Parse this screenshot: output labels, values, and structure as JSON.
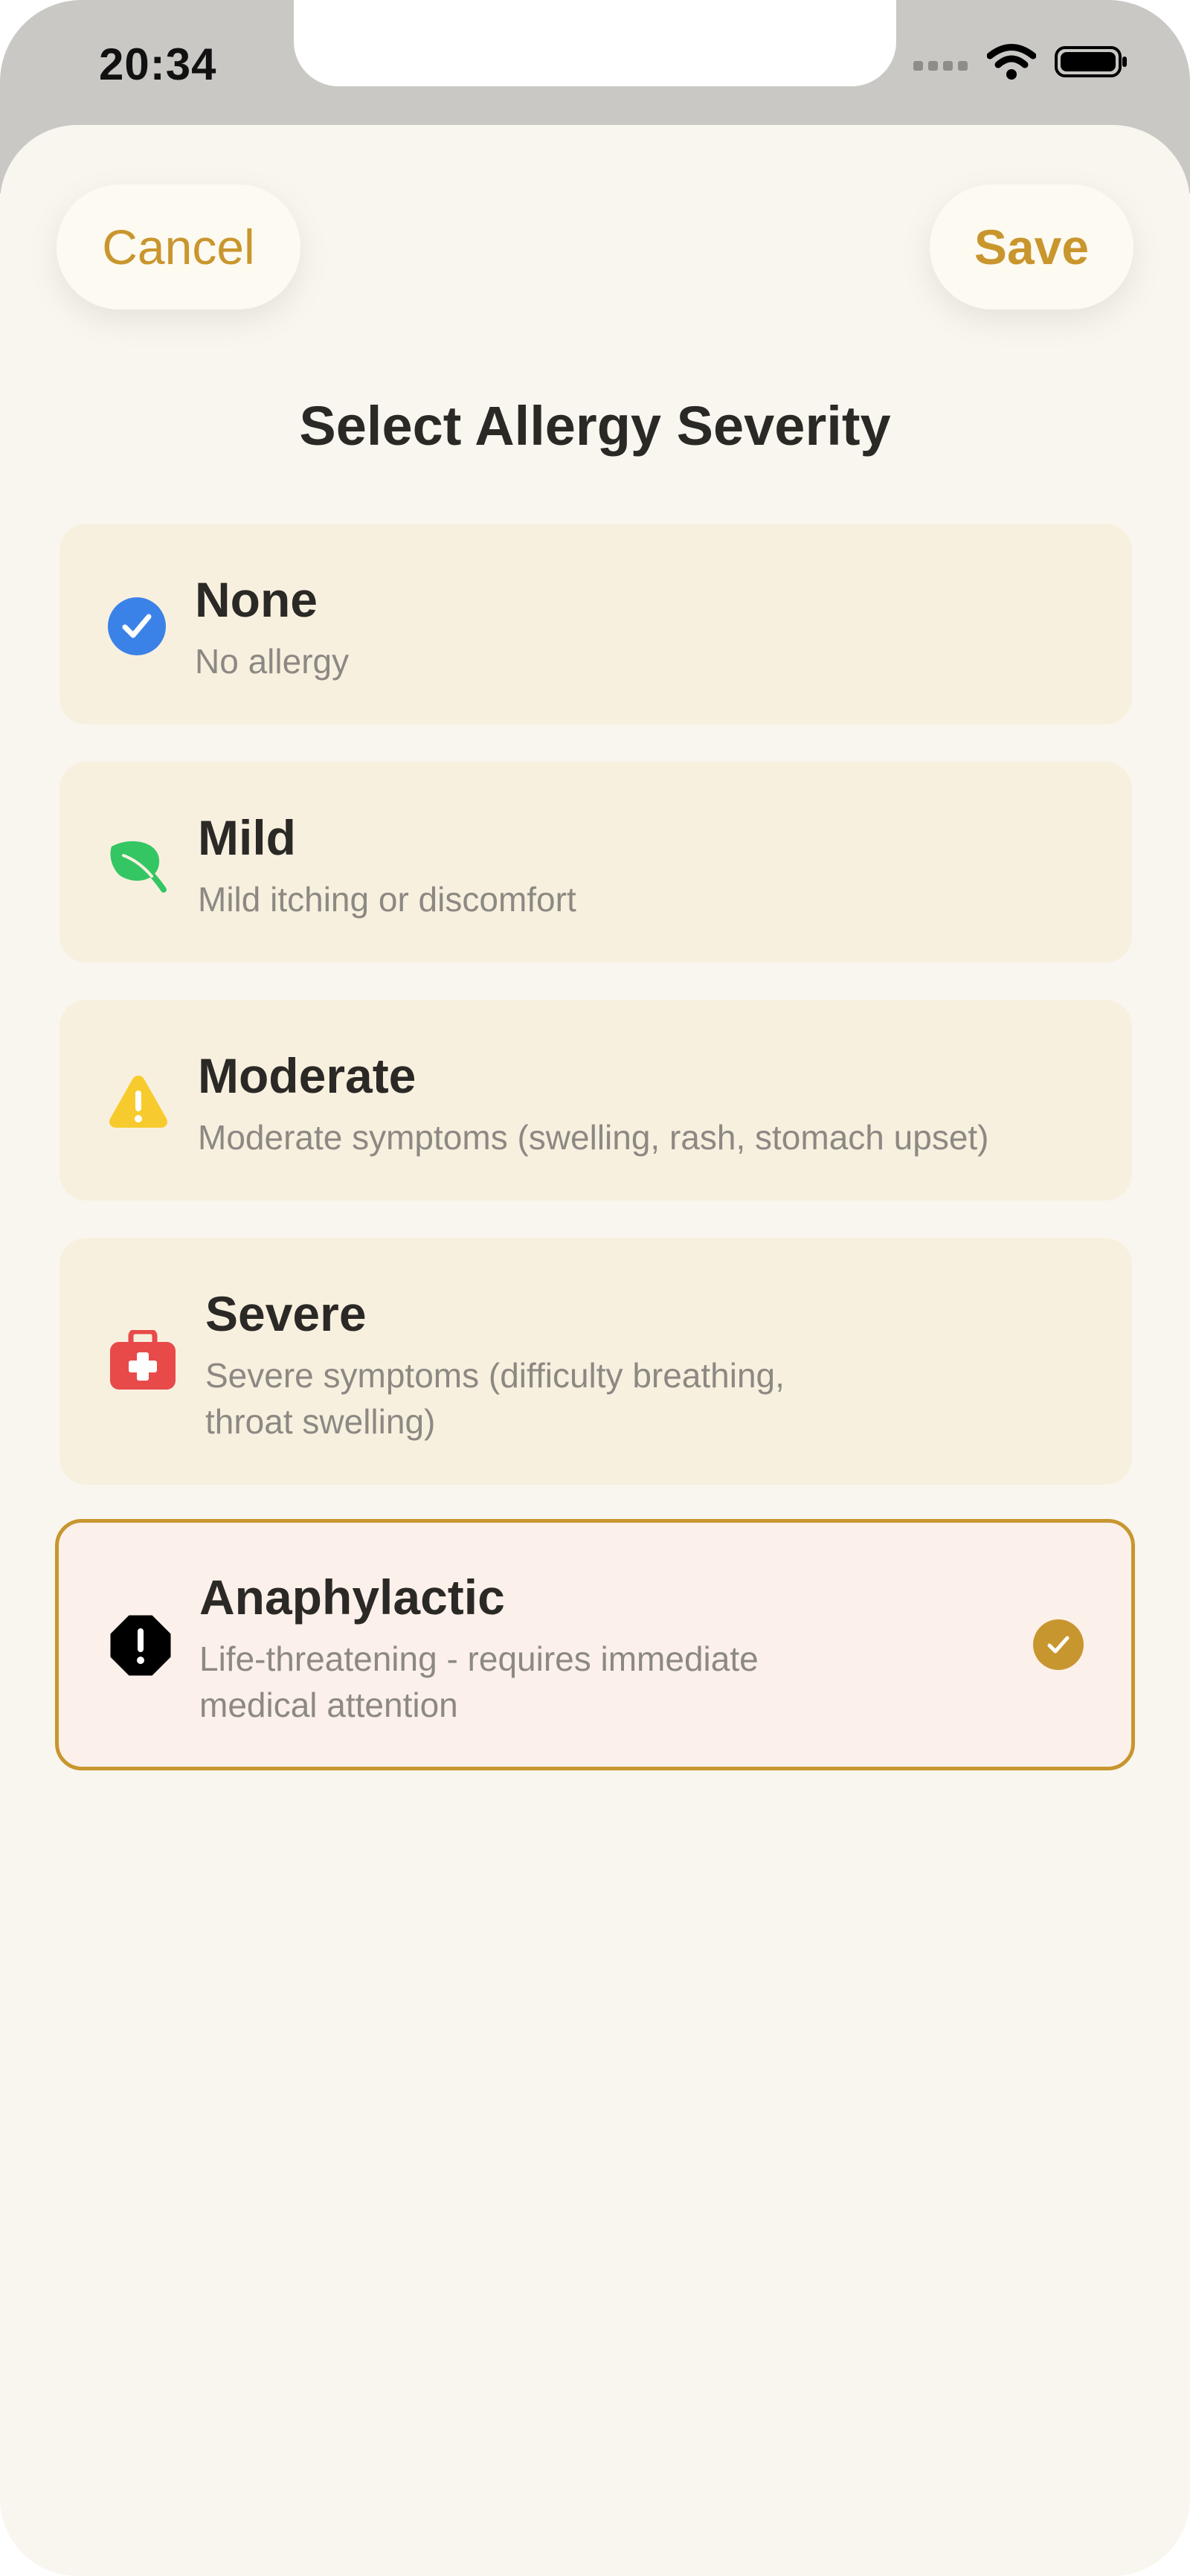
{
  "status_bar": {
    "time": "20:34"
  },
  "toolbar": {
    "cancel_label": "Cancel",
    "save_label": "Save"
  },
  "title": "Select Allergy Severity",
  "options": [
    {
      "title": "None",
      "description": "No allergy",
      "icon": "checkmark-circle-icon",
      "icon_color": "#3b82e8"
    },
    {
      "title": "Mild",
      "description": "Mild itching or discomfort",
      "icon": "leaf-icon",
      "icon_color": "#34c663"
    },
    {
      "title": "Moderate",
      "description": "Moderate symptoms (swelling, rash, stomach upset)",
      "icon": "warning-triangle-icon",
      "icon_color": "#f7cb2d"
    },
    {
      "title": "Severe",
      "description_line1": "Severe symptoms (difficulty breathing,",
      "description_line2": "throat swelling)",
      "icon": "medical-kit-icon",
      "icon_color": "#e84a4a"
    },
    {
      "title": "Anaphylactic",
      "description_line1": "Life-threatening - requires immediate",
      "description_line2": "medical attention",
      "icon": "exclamation-octagon-icon",
      "icon_color": "#000000",
      "selected": true
    }
  ],
  "colors": {
    "accent": "#c8962f",
    "card": "#f8f0df",
    "selected_card": "#fcf0ea",
    "background": "#f9f6ef"
  }
}
